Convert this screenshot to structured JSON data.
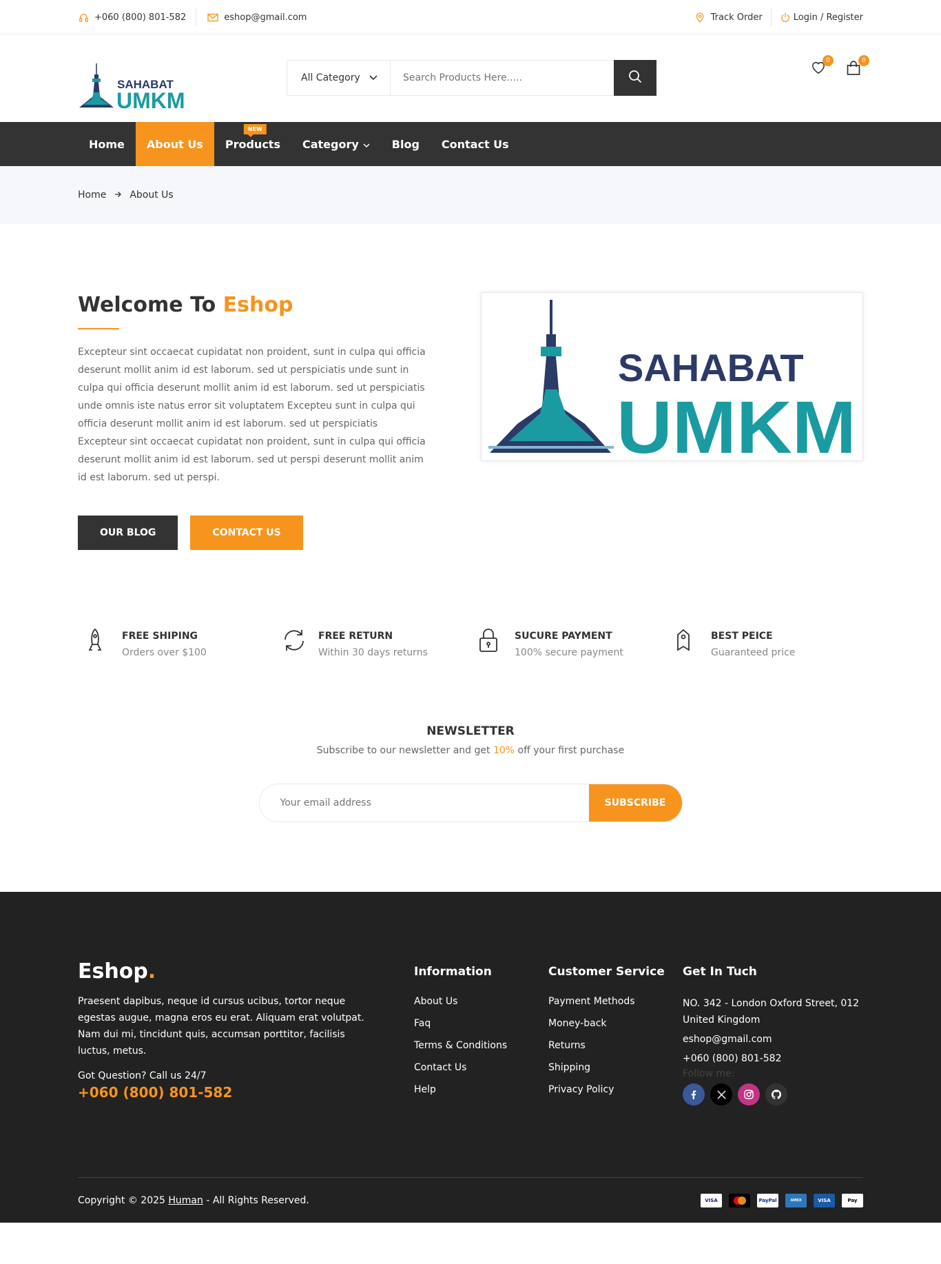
{
  "topbar": {
    "phone": "+060 (800) 801-582",
    "email": "eshop@gmail.com",
    "track_order": "Track Order",
    "login": "Login / Register"
  },
  "header": {
    "logo_top": "SAHABAT",
    "logo_bottom": "UMKM",
    "category_select": "All Category",
    "search_placeholder": "Search Products Here.....",
    "wishlist_count": "0",
    "cart_count": "0"
  },
  "nav": {
    "items": [
      {
        "label": "Home"
      },
      {
        "label": "About Us"
      },
      {
        "label": "Products",
        "tag": "NEW"
      },
      {
        "label": "Category"
      },
      {
        "label": "Blog"
      },
      {
        "label": "Contact Us"
      }
    ]
  },
  "breadcrumb": {
    "home": "Home",
    "current": "About Us"
  },
  "about": {
    "title_prefix": "Welcome To ",
    "title_accent": "Eshop",
    "paragraph": "Excepteur sint occaecat cupidatat non proident, sunt in culpa qui officia deserunt mollit anim id est laborum. sed ut perspiciatis unde sunt in culpa qui officia deserunt mollit anim id est laborum. sed ut perspiciatis unde omnis iste natus error sit voluptatem Excepteu sunt in culpa qui officia deserunt mollit anim id est laborum. sed ut perspiciatis Excepteur sint occaecat cupidatat non proident, sunt in culpa qui officia deserunt mollit anim id est laborum. sed ut perspi deserunt mollit anim id est laborum. sed ut perspi.",
    "blog_button": "OUR BLOG",
    "contact_button": "CONTACT US",
    "image_logo_top": "SAHABAT",
    "image_logo_bottom": "UMKM"
  },
  "features": [
    {
      "title": "FREE SHIPING",
      "sub": "Orders over $100",
      "icon": "rocket-icon"
    },
    {
      "title": "FREE RETURN",
      "sub": "Within 30 days returns",
      "icon": "refresh-icon"
    },
    {
      "title": "SUCURE PAYMENT",
      "sub": "100% secure payment",
      "icon": "lock-icon"
    },
    {
      "title": "BEST PEICE",
      "sub": "Guaranteed price",
      "icon": "tag-icon"
    }
  ],
  "newsletter": {
    "title": "NEWSLETTER",
    "sub_prefix": "Subscribe to our newsletter and get ",
    "sub_accent": "10%",
    "sub_suffix": " off your first purchase",
    "placeholder": "Your email address",
    "button": "SUBSCRIBE"
  },
  "footer": {
    "logo": "Eshop",
    "logo_dot": ".",
    "about": "Praesent dapibus, neque id cursus ucibus, tortor neque egestas augue, magna eros eu erat. Aliquam erat volutpat. Nam dui mi, tincidunt quis, accumsan porttitor, facilisis luctus, metus.",
    "question": "Got Question? Call us 24/7",
    "phone": "+060 (800) 801-582",
    "information": {
      "title": "Information",
      "links": [
        "About Us",
        "Faq",
        "Terms & Conditions",
        "Contact Us",
        "Help"
      ]
    },
    "customer_service": {
      "title": "Customer Service",
      "links": [
        "Payment Methods",
        "Money-back",
        "Returns",
        "Shipping",
        "Privacy Policy"
      ]
    },
    "contact": {
      "title": "Get In Tuch",
      "address": "NO. 342 - London Oxford Street, 012 United Kingdom",
      "email": "eshop@gmail.com",
      "phone": "+060 (800) 801-582",
      "follow": "Follow me:"
    },
    "copyright_prefix": "Copyright © 2025 ",
    "copyright_link": "Human",
    "copyright_suffix": " - All Rights Reserved.",
    "payments": [
      "VISA",
      "mastercard",
      "PayPal",
      "AMEX",
      "VISA",
      "Pay"
    ]
  },
  "colors": {
    "accent": "#f7941d",
    "dark": "#333333",
    "footer_bg": "#222222",
    "logo_teal": "#1a9ba1",
    "logo_navy": "#2b3a67"
  }
}
